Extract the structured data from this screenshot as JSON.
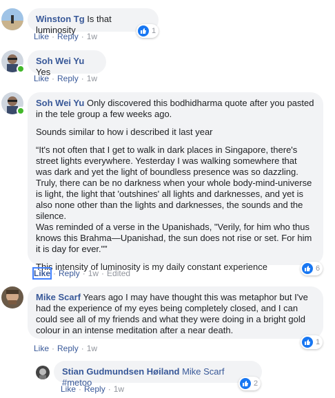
{
  "comments": [
    {
      "author": "Winston Tg",
      "text": "Is that luminosity",
      "like": "Like",
      "reply": "Reply",
      "time": "1w",
      "reactions": "1"
    },
    {
      "author": "Soh Wei Yu",
      "text": "Yes",
      "like": "Like",
      "reply": "Reply",
      "time": "1w"
    },
    {
      "author": "Soh Wei Yu",
      "text": "Only discovered this bodhidharma quote after you pasted in the tele group a few weeks ago.",
      "para2": "Sounds similar to how i described it last year",
      "para3": "“It's not often that I get to walk in dark places in Singapore, there's street lights everywhere. Yesterday I was walking somewhere that was dark and yet the light of boundless presence was so dazzling. Truly, there can be no darkness when your whole body-mind-universe is light, the light that 'outshines' all lights and darknesses, and yet is also none other than the lights and darknesses, the sounds and the silence.",
      "para4": "Was reminded of a verse in the Upanishads, \"Verily, for him who thus knows this Brahma—Upanishad, the sun does not rise or set. For him it is day for ever.\"”",
      "para5": "This intensity of luminosity is my daily constant experience",
      "like": "Like",
      "reply": "Reply",
      "time": "1w",
      "edited": "Edited",
      "reactions": "6"
    },
    {
      "author": "Mike Scarf",
      "text": "Years ago I may have thought this was metaphor but I've had the experience of my eyes being completely closed, and I can could see all of my friends and what they were doing in a bright gold colour in an intense meditation after a near death.",
      "like": "Like",
      "reply": "Reply",
      "time": "1w",
      "reactions": "1"
    },
    {
      "author": "Stian Gudmundsen Høiland",
      "mention": "Mike Scarf",
      "hashtag": "#metoo",
      "like": "Like",
      "reply": "Reply",
      "time": "1w",
      "reactions": "2"
    }
  ],
  "colors": {
    "link": "#385898",
    "bubble": "#f2f3f5",
    "like_blue": "#1877f2",
    "online": "#42b72a"
  },
  "icons": {
    "reaction": "thumbs-up-icon"
  }
}
